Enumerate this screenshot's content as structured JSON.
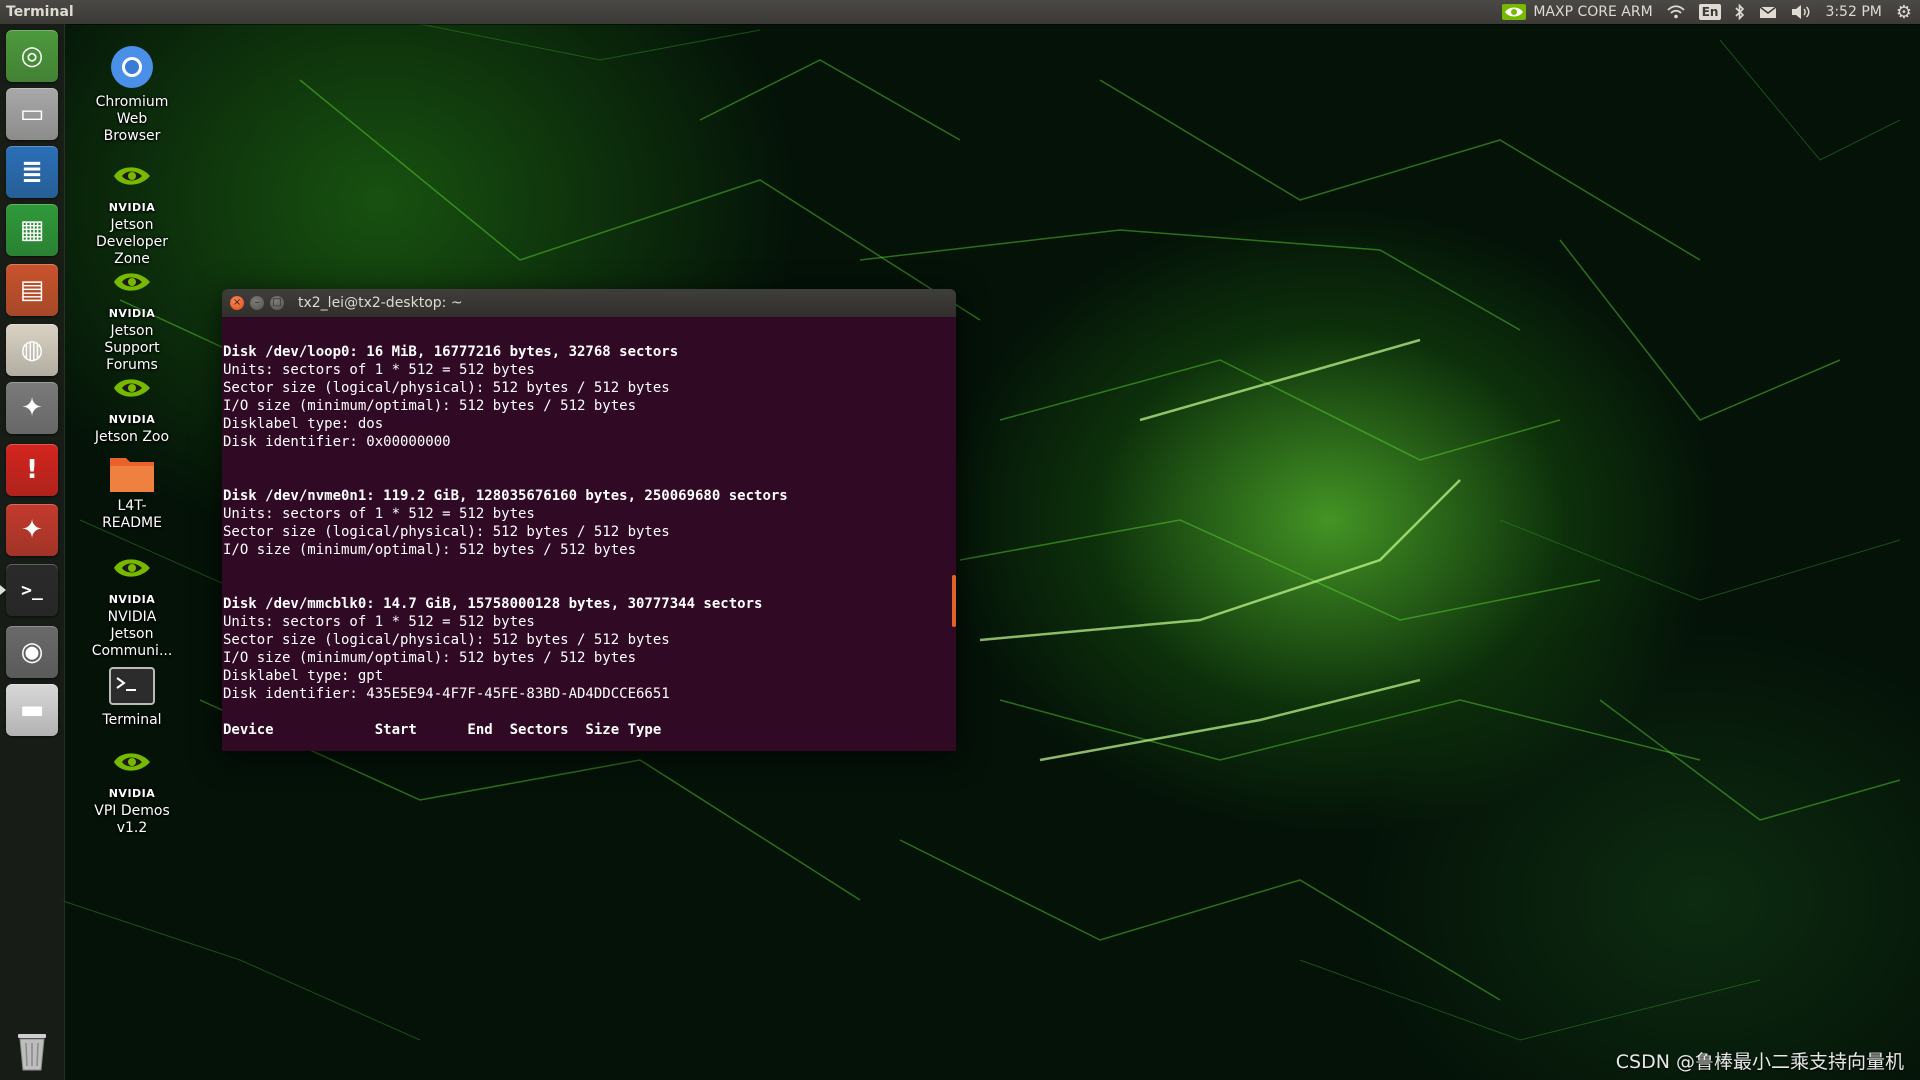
{
  "top_panel": {
    "app_title": "Terminal",
    "power_mode": "MAXP CORE ARM",
    "keyboard_layout": "En",
    "clock": "3:52 PM"
  },
  "launcher": {
    "items": [
      {
        "name": "Ubuntu Dash",
        "icon": "ubuntu-logo-icon",
        "color": "#4d9a3c",
        "glyph": "◎"
      },
      {
        "name": "Files",
        "icon": "file-cabinet-icon",
        "color": "#a8a8a8",
        "glyph": "▭"
      },
      {
        "name": "LibreOffice Writer",
        "icon": "writer-document-icon",
        "color": "#2b6fb6",
        "glyph": "≣"
      },
      {
        "name": "LibreOffice Calc",
        "icon": "calc-spreadsheet-icon",
        "color": "#2f9a3a",
        "glyph": "▦"
      },
      {
        "name": "LibreOffice Impress",
        "icon": "impress-presentation-icon",
        "color": "#c9532d",
        "glyph": "▤"
      },
      {
        "name": "Software Center",
        "icon": "shopping-bag-icon",
        "color": "#d9d2c4",
        "glyph": "◍"
      },
      {
        "name": "System Settings",
        "icon": "settings-wrench-icon",
        "color": "#7a7a7a",
        "glyph": "✦"
      },
      {
        "name": "Error Report",
        "icon": "alert-exclamation-icon",
        "color": "#d4251e",
        "glyph": "!"
      },
      {
        "name": "Settings Tools",
        "icon": "tools-wrench-icon",
        "color": "#c33a2c",
        "glyph": "✦"
      },
      {
        "name": "Terminal",
        "icon": "terminal-icon",
        "color": "#2a2a2a",
        "glyph": ">_"
      },
      {
        "name": "Screenshot",
        "icon": "camera-icon",
        "color": "#6a6a6a",
        "glyph": "◉"
      },
      {
        "name": "Drive",
        "icon": "drive-icon",
        "color": "#d8d8d8",
        "glyph": "▬"
      }
    ],
    "trash": {
      "name": "Trash",
      "icon": "trash-icon",
      "glyph": "▯"
    }
  },
  "desktop_icons": [
    {
      "label_lines": [
        "Chromium",
        "Web",
        "Browser"
      ],
      "icon": "chromium-icon"
    },
    {
      "brand": "NVIDIA",
      "label_lines": [
        "Jetson",
        "Developer",
        "Zone"
      ],
      "icon": "nvidia-eye-icon"
    },
    {
      "brand": "NVIDIA",
      "label_lines": [
        "Jetson",
        "Support",
        "Forums"
      ],
      "icon": "nvidia-eye-icon"
    },
    {
      "brand": "NVIDIA",
      "label_lines": [
        "Jetson Zoo"
      ],
      "icon": "nvidia-eye-icon"
    },
    {
      "label_lines": [
        "L4T-",
        "README"
      ],
      "icon": "folder-icon"
    },
    {
      "brand": "NVIDIA",
      "label_lines": [
        "NVIDIA",
        "Jetson",
        "Communi..."
      ],
      "icon": "nvidia-eye-icon"
    },
    {
      "label_lines": [
        "Terminal"
      ],
      "icon": "terminal-shortcut-icon"
    },
    {
      "brand": "NVIDIA",
      "label_lines": [
        "VPI Demos",
        "v1.2"
      ],
      "icon": "nvidia-eye-icon"
    }
  ],
  "terminal": {
    "title": "tx2_lei@tx2-desktop: ~",
    "close_glyph": "×",
    "min_glyph": "–",
    "max_glyph": "□",
    "lines": [
      {
        "text": "Disk /dev/loop0: 16 MiB, 16777216 bytes, 32768 sectors",
        "bold": true
      },
      {
        "text": "Units: sectors of 1 * 512 = 512 bytes",
        "bold": false
      },
      {
        "text": "Sector size (logical/physical): 512 bytes / 512 bytes",
        "bold": false
      },
      {
        "text": "I/O size (minimum/optimal): 512 bytes / 512 bytes",
        "bold": false
      },
      {
        "text": "Disklabel type: dos",
        "bold": false
      },
      {
        "text": "Disk identifier: 0x00000000",
        "bold": false
      },
      {
        "text": "",
        "bold": false
      },
      {
        "text": "",
        "bold": false
      },
      {
        "text": "Disk /dev/nvme0n1: 119.2 GiB, 128035676160 bytes, 250069680 sectors",
        "bold": true
      },
      {
        "text": "Units: sectors of 1 * 512 = 512 bytes",
        "bold": false
      },
      {
        "text": "Sector size (logical/physical): 512 bytes / 512 bytes",
        "bold": false
      },
      {
        "text": "I/O size (minimum/optimal): 512 bytes / 512 bytes",
        "bold": false
      },
      {
        "text": "",
        "bold": false
      },
      {
        "text": "",
        "bold": false
      },
      {
        "text": "Disk /dev/mmcblk0: 14.7 GiB, 15758000128 bytes, 30777344 sectors",
        "bold": true
      },
      {
        "text": "Units: sectors of 1 * 512 = 512 bytes",
        "bold": false
      },
      {
        "text": "Sector size (logical/physical): 512 bytes / 512 bytes",
        "bold": false
      },
      {
        "text": "I/O size (minimum/optimal): 512 bytes / 512 bytes",
        "bold": false
      },
      {
        "text": "Disklabel type: gpt",
        "bold": false
      },
      {
        "text": "Disk identifier: 435E5E94-4F7F-45FE-83BD-AD4DDCCE6651",
        "bold": false
      },
      {
        "text": "",
        "bold": false
      },
      {
        "text": "Device            Start      End  Sectors  Size Type",
        "bold": true
      }
    ]
  },
  "watermark": "CSDN @鲁棒最小二乘支持向量机",
  "colors": {
    "terminal_bg": "#300a24",
    "accent_orange": "#e0632a",
    "panel_bg": "#3c3b37"
  }
}
